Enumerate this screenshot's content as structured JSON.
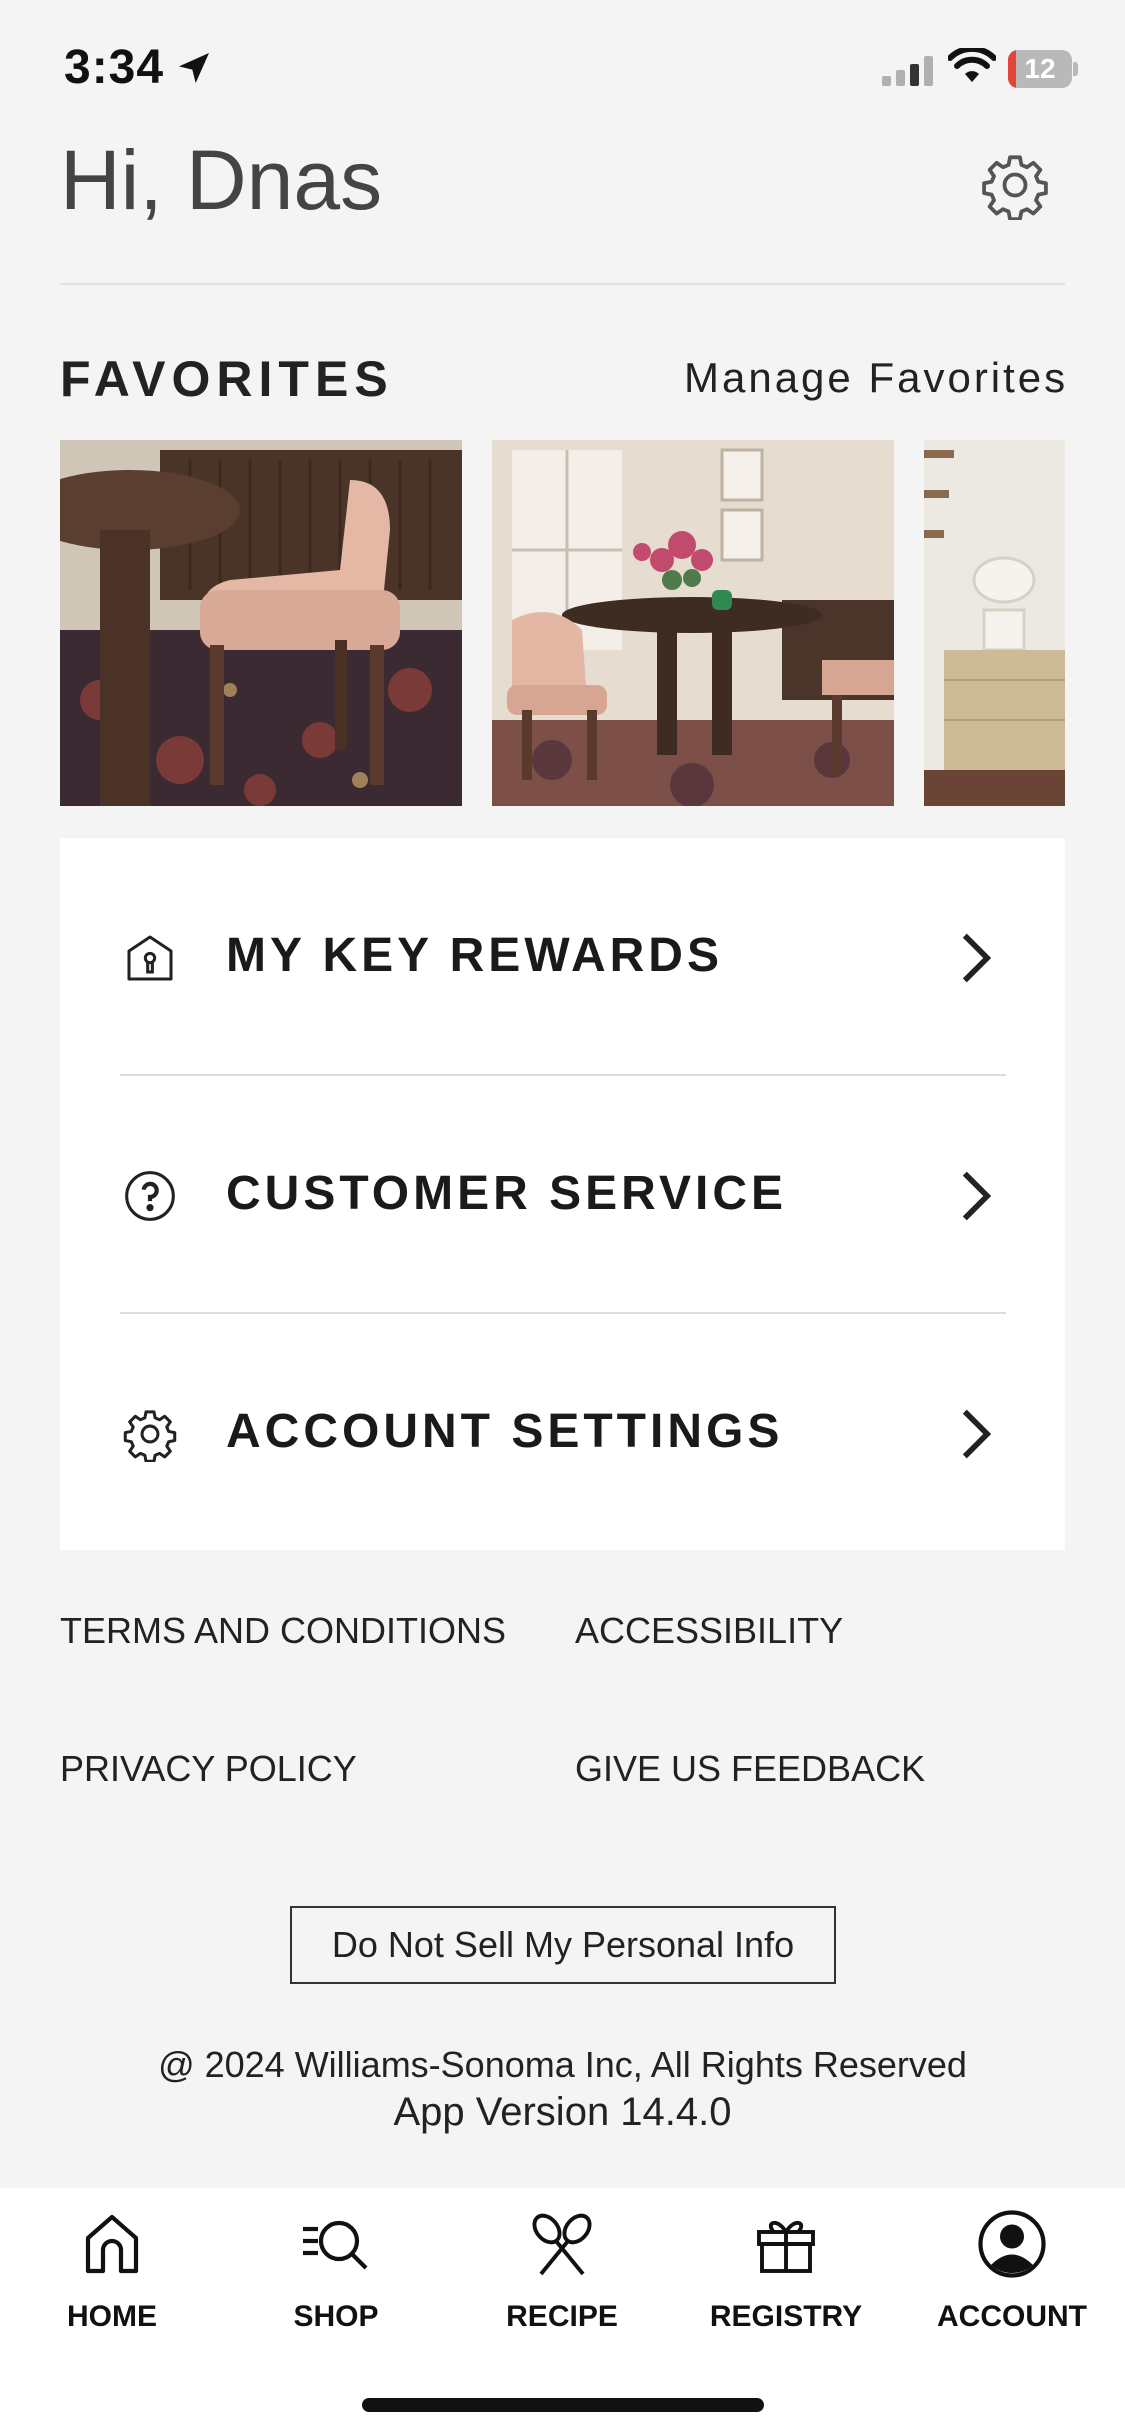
{
  "status": {
    "time": "3:34",
    "battery": "12",
    "battery_level": 0.12
  },
  "header": {
    "greeting": "Hi, Dnas"
  },
  "favorites": {
    "title": "FAVORITES",
    "manage": "Manage Favorites"
  },
  "menu": [
    {
      "label": "MY KEY REWARDS",
      "icon": "key-rewards-icon"
    },
    {
      "label": "CUSTOMER SERVICE",
      "icon": "question-icon"
    },
    {
      "label": "ACCOUNT SETTINGS",
      "icon": "gear-icon"
    }
  ],
  "links": {
    "terms": "TERMS AND CONDITIONS",
    "accessibility": "ACCESSIBILITY",
    "privacy": "PRIVACY POLICY",
    "feedback": "GIVE US FEEDBACK"
  },
  "dns_button": "Do Not Sell My Personal Info",
  "footer": {
    "copyright": "@ 2024 Williams-Sonoma Inc, All Rights Reserved",
    "version": "App Version 14.4.0"
  },
  "nav": [
    {
      "label": "HOME",
      "icon": "home-icon"
    },
    {
      "label": "SHOP",
      "icon": "search-icon"
    },
    {
      "label": "RECIPE",
      "icon": "whisk-icon"
    },
    {
      "label": "REGISTRY",
      "icon": "gift-icon"
    },
    {
      "label": "ACCOUNT",
      "icon": "account-icon"
    }
  ],
  "colors": {
    "background": "#f4f4f4",
    "battery_low": "#e0443a"
  }
}
